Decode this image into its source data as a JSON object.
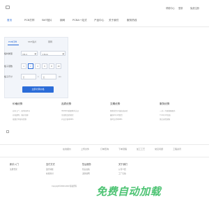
{
  "header": {
    "links": [
      "帮助中心",
      "登录",
      "免费注册"
    ]
  },
  "nav": {
    "items": [
      "首页",
      "PCB打样",
      "SMT贴片",
      "钢网",
      "PCBA一站式",
      "产品中心",
      "关于我们",
      "服务热线"
    ],
    "active_index": 0
  },
  "calculator": {
    "tabs": [
      "PCB打样",
      "SMT贴片",
      "钢网"
    ],
    "active_tab_index": 0,
    "material_label": "板材类型",
    "material_value": "FR-4",
    "thickness_value": "1.6mm",
    "layers_label": "板子层数",
    "layer_options": [
      "1",
      "2",
      "4",
      "6",
      "8",
      "10"
    ],
    "selected_layer": "2",
    "size_label": "板子尺寸",
    "length_placeholder": "长",
    "width_placeholder": "宽",
    "unit": "cm",
    "times": "×",
    "submit_label": "立即计算价格"
  },
  "features": [
    {
      "title": "价格优势",
      "lines": [
        "自有工厂，无中间环节",
        "价格透明，报价快捷",
        "批量订单更有优惠"
      ]
    },
    {
      "title": "品质优势",
      "lines": [
        "ISO9001质量体系认证",
        "全流程品质管控",
        "产品合格率99%"
      ]
    },
    {
      "title": "交期优势",
      "lines": [
        "智能化生产线高效运转",
        "最快24小时发货",
        "准时交付率98%"
      ]
    },
    {
      "title": "服务优势",
      "lines": [
        "一对一专属客服服务",
        "7×24小时在线",
        "售后无忧保障"
      ]
    }
  ],
  "strip": {
    "items": [
      "在线报价",
      "上传文件",
      "订单查询",
      "下单流程",
      "加工工艺",
      "常见问题",
      "工程资讯"
    ]
  },
  "footer": {
    "columns": [
      {
        "title": "新手入门",
        "links": [
          "注册登录"
        ]
      },
      {
        "title": "支付方式",
        "links": [
          "银行转账",
          "在线支付"
        ]
      },
      {
        "title": "售后服务",
        "links": [
          "售后政策",
          "退款说明"
        ]
      },
      {
        "title": "关于我们",
        "links": [
          "公司介绍",
          "工厂实拍"
        ]
      }
    ],
    "copyright": "Copyright©2020-2023 版权所有"
  },
  "watermark": "免费自动加载"
}
